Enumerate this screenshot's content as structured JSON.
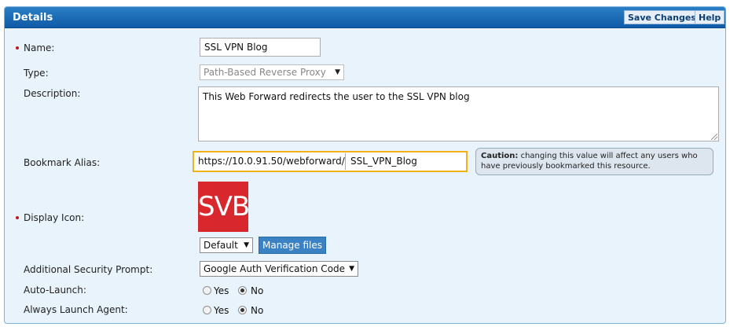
{
  "header": {
    "title": "Details",
    "save_label": "Save Changes",
    "help_label": "Help"
  },
  "fields": {
    "name": {
      "label": "Name:",
      "value": "SSL VPN Blog"
    },
    "type": {
      "label": "Type:",
      "value": "Path-Based Reverse Proxy"
    },
    "description": {
      "label": "Description:",
      "value": "This Web Forward redirects the user to the SSL VPN blog"
    },
    "bookmark_alias": {
      "label": "Bookmark Alias:",
      "prefix": "https://10.0.91.50/webforward/",
      "value": "SSL_VPN_Blog",
      "caution_strong": "Caution:",
      "caution_text": " changing this value will affect any users who have previously bookmarked this resource."
    },
    "display_icon": {
      "label": "Display Icon:",
      "icon_text": "SVB",
      "select_value": "Default",
      "manage_label": "Manage files"
    },
    "security_prompt": {
      "label": "Additional Security Prompt:",
      "value": "Google Auth Verification Code"
    },
    "auto_launch": {
      "label": "Auto-Launch:",
      "yes": "Yes",
      "no": "No",
      "selected": "No"
    },
    "always_launch_agent": {
      "label": "Always Launch Agent:",
      "yes": "Yes",
      "no": "No",
      "selected": "No"
    }
  },
  "colors": {
    "header": "#1a6db8",
    "panel_bg": "#e8f3fb",
    "required_marker": "#c0161c",
    "alias_highlight": "#f0b216",
    "icon_bg": "#d9272e",
    "manage_button": "#3b82c4"
  }
}
